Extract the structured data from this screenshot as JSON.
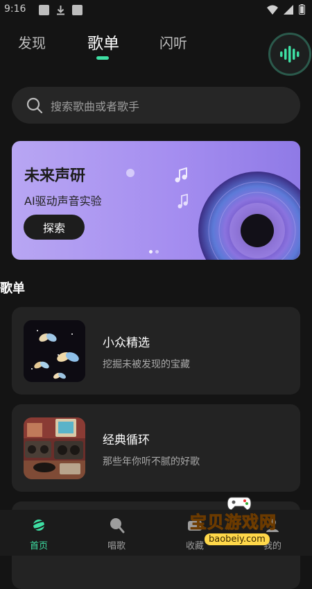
{
  "status_bar": {
    "time": "9:16"
  },
  "tabs": [
    {
      "label": "发现"
    },
    {
      "label": "歌单"
    },
    {
      "label": "闪听"
    }
  ],
  "active_tab": "歌单",
  "search": {
    "placeholder": "搜索歌曲或者歌手"
  },
  "banner": {
    "title": "未来声研",
    "subtitle": "AI驱动声音实验",
    "button": "探索",
    "page_count": 2,
    "current_page": 1
  },
  "section": {
    "title": "歌单"
  },
  "playlists": [
    {
      "title": "小众精选",
      "description": "挖掘未被发现的宝藏"
    },
    {
      "title": "经典循环",
      "description": "那些年你听不腻的好歌"
    }
  ],
  "bottom_nav": [
    {
      "label": "首页",
      "icon": "planet-icon",
      "active": true
    },
    {
      "label": "唱歌",
      "icon": "microphone-icon"
    },
    {
      "label": "收藏",
      "icon": "favorites-icon"
    },
    {
      "label": "我的",
      "icon": "profile-icon"
    }
  ],
  "watermark": {
    "text": "宝贝游戏网",
    "url": "baobeiy.com"
  },
  "colors": {
    "accent": "#3ee0a4",
    "background": "#141414",
    "card": "#232323",
    "banner": "#a58ef0"
  }
}
